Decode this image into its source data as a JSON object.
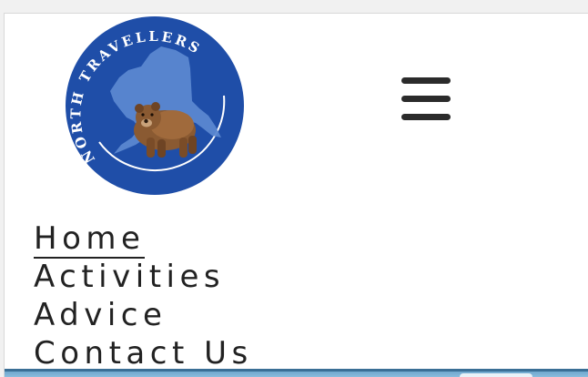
{
  "logo": {
    "arc_text": "NORTH TRAVELLERS",
    "colors": {
      "disc": "#1f4ea8",
      "map": "#5b87d0",
      "ring": "#ffffff"
    },
    "icon": "bear-icon"
  },
  "menu_button": {
    "icon": "hamburger-menu-icon"
  },
  "nav": {
    "items": [
      {
        "label": "Home",
        "active": true
      },
      {
        "label": "Activities",
        "active": false
      },
      {
        "label": "Advice",
        "active": false
      },
      {
        "label": "Contact Us",
        "active": false
      }
    ]
  }
}
